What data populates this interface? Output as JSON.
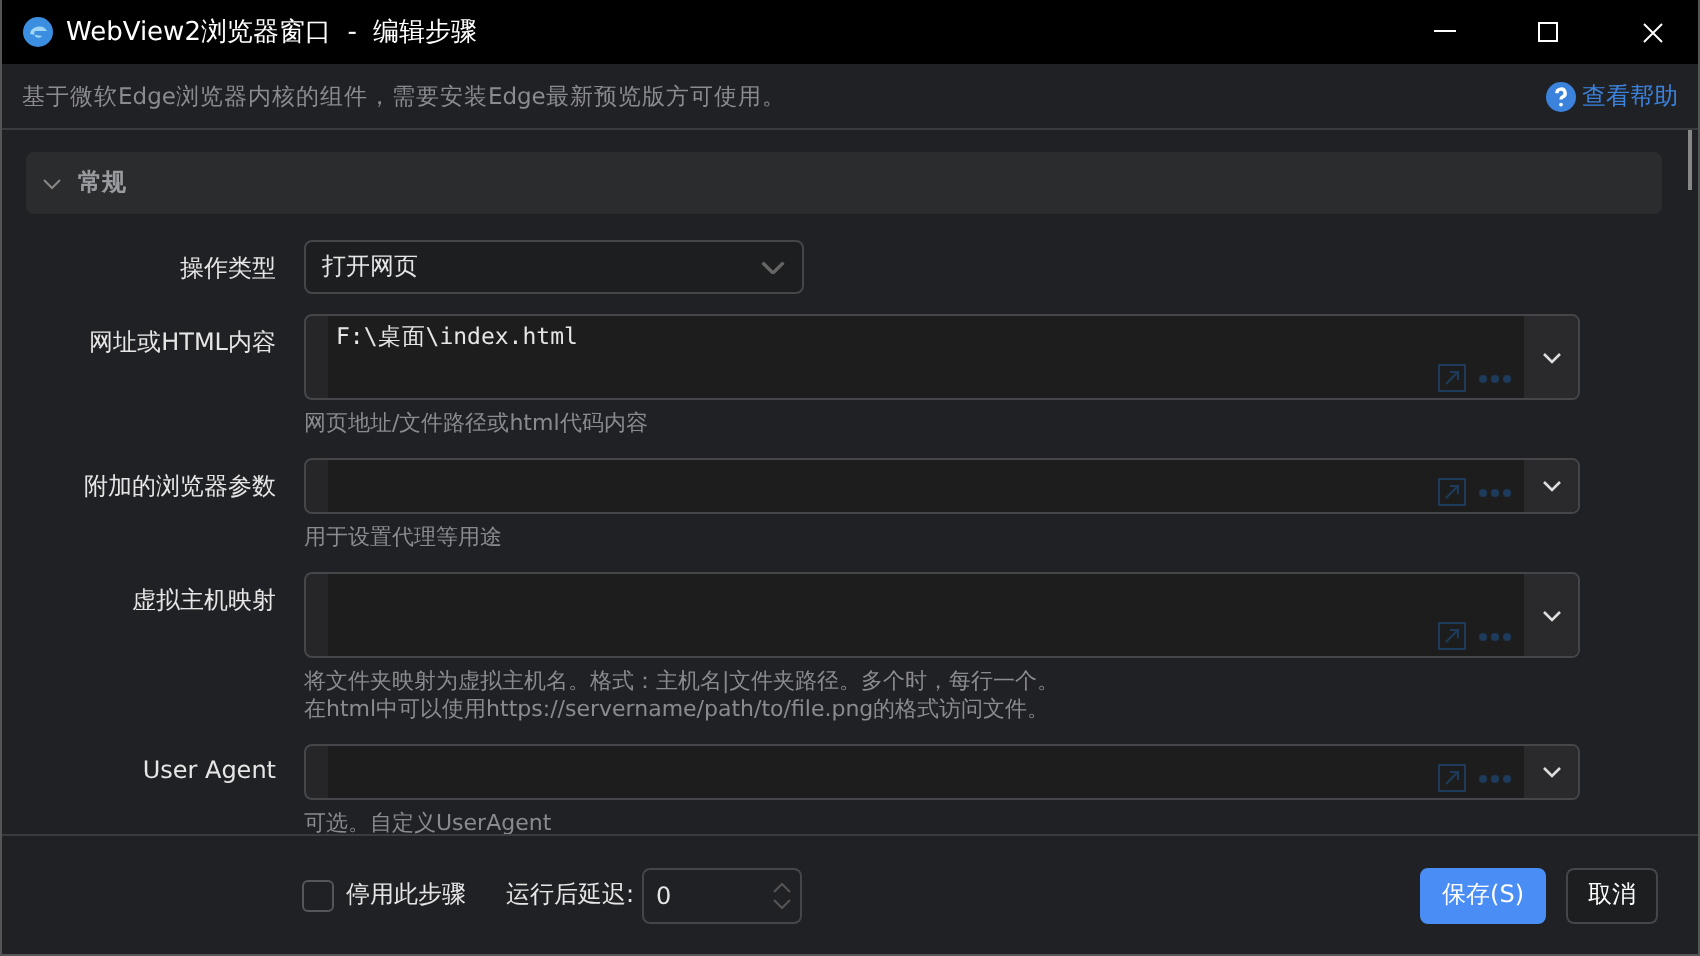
{
  "window": {
    "title": "WebView2浏览器窗口  -  编辑步骤"
  },
  "info_bar": {
    "text": "基于微软Edge浏览器内核的组件，需要安装Edge最新预览版方可使用。",
    "help_link": "查看帮助"
  },
  "section": {
    "title": "常规",
    "expanded": true
  },
  "operation": {
    "label": "操作类型",
    "value": "打开网页"
  },
  "fields": [
    {
      "label": "网址或HTML内容",
      "value": "F:\\桌面\\index.html",
      "multiline": true,
      "hint_lines": [
        "网页地址/文件路径或html代码内容"
      ]
    },
    {
      "label": "附加的浏览器参数",
      "multiline": false,
      "hint_lines": [
        "用于设置代理等用途"
      ]
    },
    {
      "label": "虚拟主机映射",
      "multiline": true,
      "hint_lines": [
        "将文件夹映射为虚拟主机名。格式：主机名|文件夹路径。多个时，每行一个。",
        "在html中可以使用https://servername/path/to/file.png的格式访问文件。"
      ]
    },
    {
      "label": "User Agent",
      "multiline": false,
      "hint_lines": [
        "可选。自定义UserAgent"
      ]
    }
  ],
  "footer": {
    "disable_step": {
      "label": "停用此步骤",
      "checked": false
    },
    "delay": {
      "label": "运行后延迟:",
      "value": "0"
    },
    "buttons": [
      {
        "label": "保存(S)",
        "primary": true
      },
      {
        "label": "取消",
        "primary": false
      }
    ]
  }
}
